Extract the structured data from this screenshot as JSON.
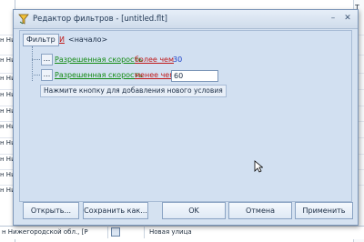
{
  "background": {
    "left_rows": [
      "н Ни",
      "н Ни",
      "н Ни",
      "н Ни",
      "н Ни",
      "н Ни",
      "н Ни",
      "н Ни",
      "н Ни",
      "н Ни"
    ],
    "right_header": "Т",
    "bottom_row": {
      "text1": "н Нижегородской обл., [Р",
      "text2": "Новая улица"
    }
  },
  "dialog": {
    "title": "Редактор фильтров - [untitled.flt]",
    "controls": {
      "minimize": "–",
      "close": "✕"
    },
    "filter_tag": "Фильтр",
    "group_op": "И",
    "group_start": "<начало>",
    "conditions": [
      {
        "button": "...",
        "field": "Разрешенная скорость",
        "operator": "более чем",
        "value": "30"
      },
      {
        "button": "...",
        "field": "Разрешенная скорость",
        "operator": "менее чем",
        "value": "60"
      }
    ],
    "add_condition": "Нажмите кнопку для добавления нового условия",
    "buttons": {
      "open": "Открыть...",
      "save_as": "Сохранить как...",
      "ok": "OK",
      "cancel": "Отмена",
      "apply": "Применить"
    }
  },
  "colors": {
    "field": "#128a12",
    "operator": "#c01818",
    "value": "#1a3ec8",
    "dialog_bg": "#d5e2f1"
  }
}
